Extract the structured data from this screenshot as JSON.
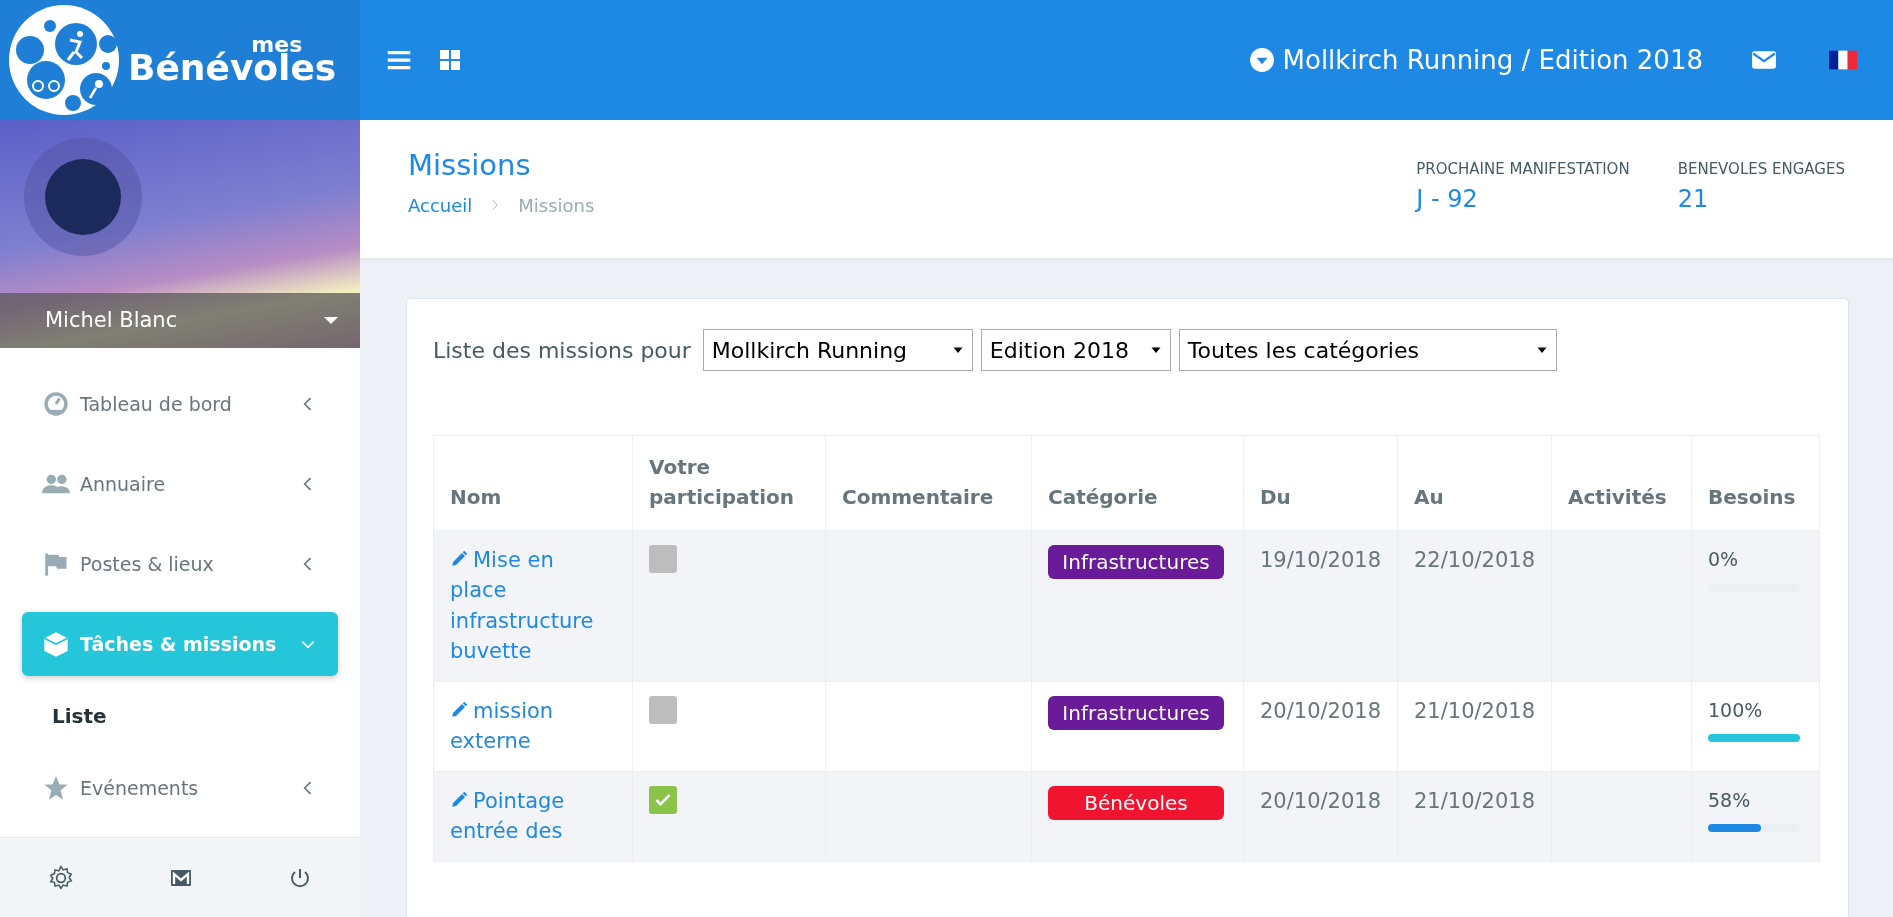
{
  "logo": {
    "small": "mes",
    "large": "Bénévoles"
  },
  "topbar": {
    "event": "Mollkirch Running / Edition 2018"
  },
  "user": {
    "name": "Michel Blanc"
  },
  "menu": [
    {
      "label": "Tableau de bord",
      "selected": false,
      "expanded": false
    },
    {
      "label": "Annuaire",
      "selected": false,
      "expanded": false
    },
    {
      "label": "Postes & lieux",
      "selected": false,
      "expanded": false
    },
    {
      "label": "Tâches & missions",
      "selected": true,
      "expanded": true,
      "children": [
        {
          "label": "Liste"
        }
      ]
    },
    {
      "label": "Evénements",
      "selected": false,
      "expanded": false
    }
  ],
  "page": {
    "title": "Missions",
    "breadcrumb": [
      "Accueil",
      "Missions"
    ],
    "stats": [
      {
        "label": "PROCHAINE MANIFESTATION",
        "value": "J - 92"
      },
      {
        "label": "BENEVOLES ENGAGES",
        "value": "21"
      }
    ]
  },
  "filters": {
    "label": "Liste des missions pour",
    "selects": [
      "Mollkirch Running",
      "Edition 2018",
      "Toutes les catégories"
    ]
  },
  "table": {
    "columns": [
      "Nom",
      "Votre participation",
      "Commentaire",
      "Catégorie",
      "Du",
      "Au",
      "Activités",
      "Besoins"
    ],
    "rows": [
      {
        "name": "Mise en place infrastructure buvette",
        "checked": false,
        "category": "Infrastructures",
        "color": "#6a1b9a",
        "from": "19/10/2018",
        "to": "22/10/2018",
        "need": "0%",
        "level": 0
      },
      {
        "name": "mission externe",
        "checked": false,
        "category": "Infrastructures",
        "color": "#6a1b9a",
        "from": "20/10/2018",
        "to": "21/10/2018",
        "need": "100%",
        "level": 1
      },
      {
        "name": "Pointage entrée des",
        "checked": true,
        "category": "Bénévoles",
        "color": "#f0142f",
        "from": "20/10/2018",
        "to": "21/10/2018",
        "need": "58%",
        "level": 0.58
      }
    ]
  }
}
